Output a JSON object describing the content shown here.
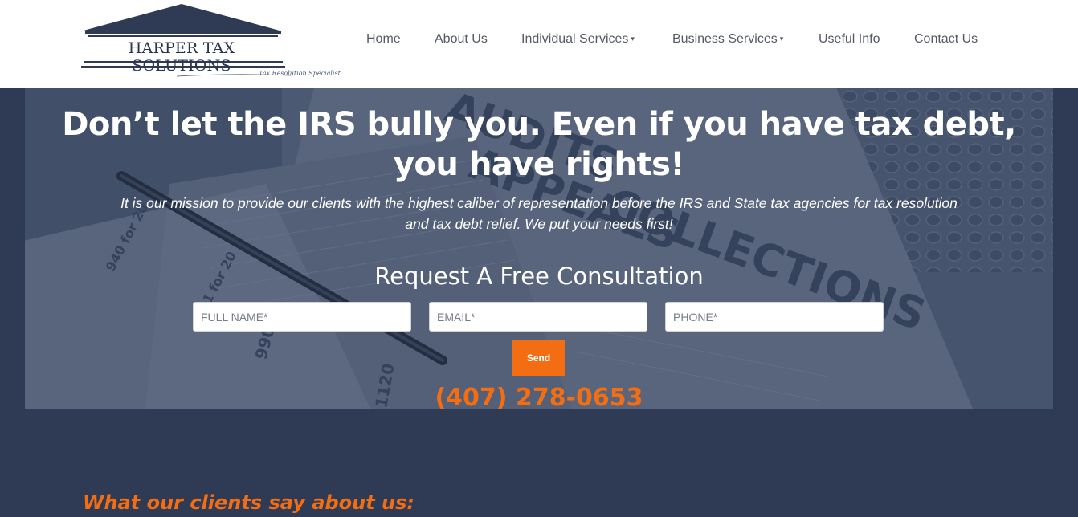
{
  "brand": {
    "name": "Harper Tax Solutions",
    "logo_text": "HARPER TAX SOLUTIONS",
    "tagline": "Tax Resolution Specialist"
  },
  "nav": {
    "items": [
      {
        "label": "Home",
        "dropdown": false
      },
      {
        "label": "About Us",
        "dropdown": false
      },
      {
        "label": "Individual Services",
        "dropdown": true
      },
      {
        "label": "Business Services",
        "dropdown": true
      },
      {
        "label": "Useful Info",
        "dropdown": false
      },
      {
        "label": "Contact Us",
        "dropdown": false
      }
    ],
    "dropdown_caret": "▾"
  },
  "hero": {
    "headline_line1": "Don’t let the IRS bully you.  Even if you have tax debt,",
    "headline_line2": "you have rights!",
    "mission_line1": "It is our mission to provide our clients with the highest caliber of representation before the IRS and State tax agencies for tax resolution",
    "mission_line2": "and tax debt relief.  We put your needs first!",
    "background_words": [
      "AUDITS",
      "APPEALS",
      "COLLECTIONS",
      "990",
      "1120",
      "941 for 20",
      "940 for 20"
    ]
  },
  "form": {
    "title": "Request A Free Consultation",
    "full_name_placeholder": "FULL NAME*",
    "email_placeholder": "EMAIL*",
    "phone_placeholder": "PHONE*",
    "send_label": "Send"
  },
  "contact": {
    "phone": "(407) 278-0653"
  },
  "testimonials": {
    "title": "What our clients say about us:"
  },
  "colors": {
    "navy": "#2f3b55",
    "accent_orange": "#f36d12",
    "nav_text": "#555a63"
  }
}
